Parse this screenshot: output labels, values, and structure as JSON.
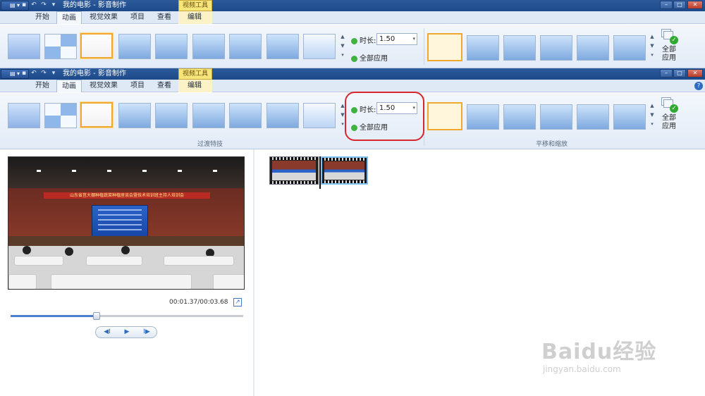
{
  "window": {
    "title": "我的电影 - 影音制作",
    "context_tab": "视频工具",
    "tabs": [
      "开始",
      "动画",
      "视觉效果",
      "项目",
      "查看",
      "编辑"
    ],
    "active_tab": "动画"
  },
  "ribbon": {
    "duration_label": "时长:",
    "duration_value": "1.50",
    "apply_all_label": "全部应用",
    "big_apply_line1": "全部",
    "big_apply_line2": "应用",
    "transitions_group_label": "过渡特技",
    "pan_zoom_group_label": "平移和缩放"
  },
  "player": {
    "time": "00:01.37/00:03.68",
    "progress": 0.37,
    "prev_icon": "◀I",
    "play_icon": "▶",
    "next_icon": "I▶"
  },
  "video_banner": "山东省莒大棚种植蔬菜种植座谈会暨技术培训班主持人培训会",
  "watermark": {
    "line1": "Baidu经验",
    "line2": "jingyan.baidu.com"
  },
  "colors": {
    "title_bar": "#1d4a8a",
    "selection": "#f0a830",
    "highlight_box": "#d8262f",
    "context_tab": "#f6e67a"
  }
}
